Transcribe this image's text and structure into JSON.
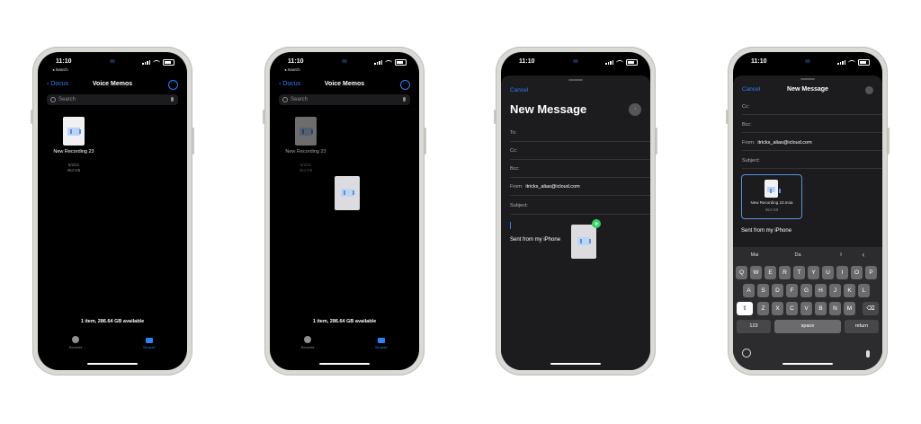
{
  "phone1": {
    "status": {
      "time": "11:10",
      "back_hint": "◂ Search"
    },
    "nav": {
      "back": "Docus",
      "title": "Voice Memos",
      "more": "···"
    },
    "search": {
      "placeholder": "Search"
    },
    "file": {
      "name": "New Recording 23",
      "date": "5/2/21",
      "size": "364 KB"
    },
    "footer": "1 item, 286.64 GB available",
    "tabs": [
      {
        "label": "Recents"
      },
      {
        "label": "Browse"
      }
    ]
  },
  "phone2": {
    "status": {
      "time": "11:10",
      "back_hint": "◂ Search"
    },
    "nav": {
      "back": "Docus",
      "title": "Voice Memos",
      "more": "···"
    },
    "search": {
      "placeholder": "Search"
    },
    "file": {
      "name": "New Recording 23",
      "date": "5/2/21",
      "size": "364 KB"
    },
    "footer": "1 item, 286.64 GB available",
    "tabs": [
      {
        "label": "Recents"
      },
      {
        "label": "Browse"
      }
    ]
  },
  "phone3": {
    "status": {
      "time": "11:10"
    },
    "cancel": "Cancel",
    "title": "New Message",
    "fields": {
      "to": "To:",
      "cc": "Cc:",
      "bcc": "Bcc:",
      "from_label": "From:",
      "from_value": "itricks_alias@icloud.com",
      "subject": "Subject:"
    },
    "signature": "Sent from my iPhone",
    "send": "↑",
    "plus": "+"
  },
  "phone4": {
    "status": {
      "time": "11:10"
    },
    "cancel": "Cancel",
    "title": "New Message",
    "fields": {
      "cc": "Cc:",
      "bcc": "Bcc:",
      "from_label": "From:",
      "from_value": "itricks_alias@icloud.com",
      "subject": "Subject:"
    },
    "attachment": {
      "name": "New Recording 23.m4a",
      "size": "364 KB"
    },
    "signature": "Sent from my iPhone",
    "suggestions": [
      "Mai",
      "Da",
      "I"
    ],
    "keyboard": {
      "row1": [
        "Q",
        "W",
        "E",
        "R",
        "T",
        "Y",
        "U",
        "I",
        "O",
        "P"
      ],
      "row2": [
        "A",
        "S",
        "D",
        "F",
        "G",
        "H",
        "J",
        "K",
        "L"
      ],
      "row3": [
        "Z",
        "X",
        "C",
        "V",
        "B",
        "N",
        "M"
      ],
      "numbers": "123",
      "space": "space",
      "return": "return"
    }
  },
  "colors": {
    "accent": "#2f7ff5",
    "green": "#30d158"
  }
}
